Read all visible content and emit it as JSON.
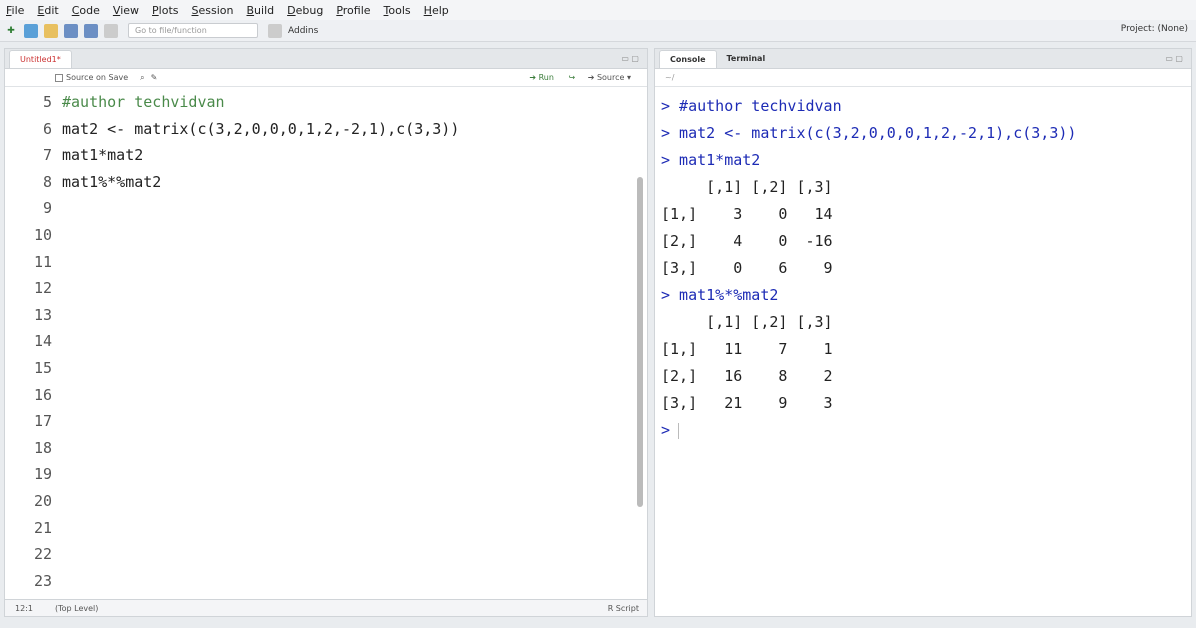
{
  "menu": [
    "File",
    "Edit",
    "Code",
    "View",
    "Plots",
    "Session",
    "Build",
    "Debug",
    "Profile",
    "Tools",
    "Help"
  ],
  "toolbar": {
    "goto_placeholder": "Go to file/function",
    "addins": "Addins",
    "project": "Project: (None)"
  },
  "editor": {
    "tab": "Untitled1*",
    "source_on_save": "Source on Save",
    "run": "Run",
    "source": "Source",
    "line_numbers": [
      "5",
      "6",
      "7",
      "8",
      "9",
      "10",
      "11",
      "12",
      "13",
      "14",
      "15",
      "16",
      "17",
      "18",
      "19",
      "20",
      "21",
      "22",
      "23"
    ],
    "lines": [
      "#author techvidvan",
      "mat2 <- matrix(c(3,2,0,0,0,1,2,-2,1),c(3,3))",
      "mat1*mat2",
      "mat1%*%mat2"
    ],
    "status_pos": "12:1",
    "status_scope": "(Top Level)",
    "status_type": "R Script"
  },
  "console": {
    "tabs": [
      "Console",
      "Terminal"
    ],
    "path": "~/",
    "lines": [
      "> #author techvidvan",
      "> mat2 <- matrix(c(3,2,0,0,0,1,2,-2,1),c(3,3))",
      "> mat1*mat2",
      "     [,1] [,2] [,3]",
      "[1,]    3    0   14",
      "[2,]    4    0  -16",
      "[3,]    0    6    9",
      "> mat1%*%mat2",
      "     [,1] [,2] [,3]",
      "[1,]   11    7    1",
      "[2,]   16    8    2",
      "[3,]   21    9    3",
      ">"
    ]
  }
}
